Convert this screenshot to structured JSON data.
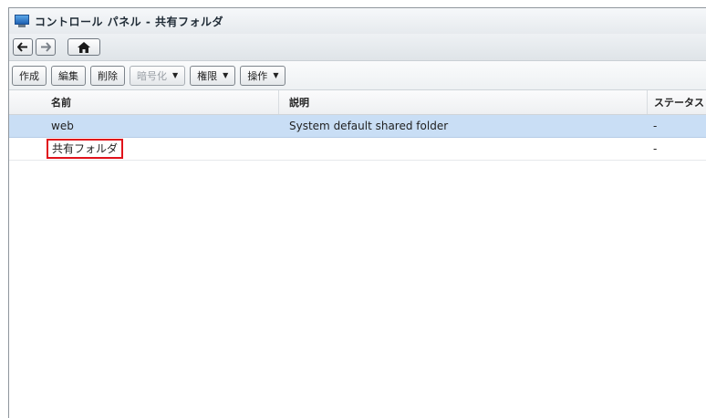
{
  "window": {
    "title": "コントロール パネル - 共有フォルダ",
    "icon": "control-panel-icon"
  },
  "nav": {
    "back_icon": "arrow-left-icon",
    "forward_icon": "arrow-right-icon",
    "home_icon": "home-icon"
  },
  "toolbar": {
    "create_label": "作成",
    "edit_label": "編集",
    "delete_label": "削除",
    "encrypt_label": "暗号化",
    "permissions_label": "権限",
    "action_label": "操作",
    "caret": "▼"
  },
  "table": {
    "columns": [
      "名前",
      "説明",
      "ステータス"
    ],
    "rows": [
      {
        "name": "web",
        "description": "System default shared folder",
        "status": "-",
        "selected": true
      },
      {
        "name": "共有フォルダ",
        "description": "",
        "status": "-",
        "selected": false,
        "highlighted": true
      }
    ]
  },
  "colors": {
    "selection": "#c9def5",
    "highlight_border": "#e0121b"
  }
}
